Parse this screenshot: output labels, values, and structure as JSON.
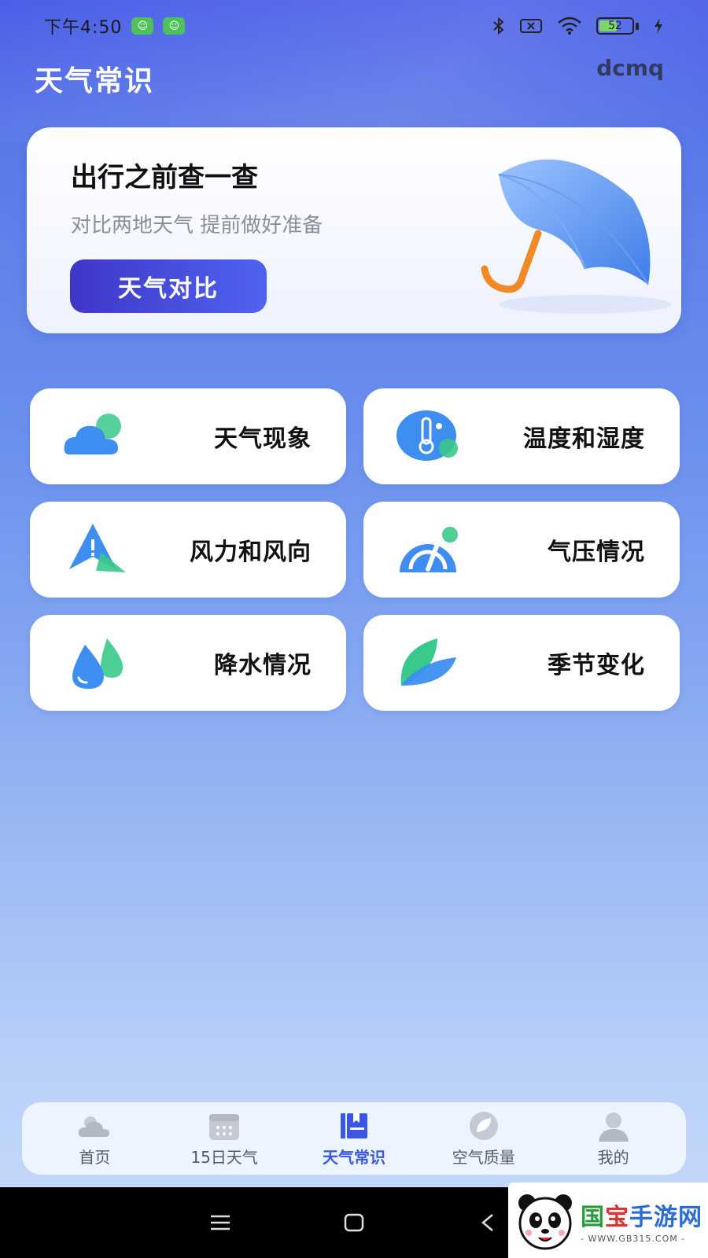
{
  "status_bar": {
    "time": "下午4:50",
    "battery": "52"
  },
  "header": {
    "title": "天气常识",
    "tag": "dcmq"
  },
  "promo": {
    "title": "出行之前查一查",
    "subtitle": "对比两地天气 提前做好准备",
    "button_label": "天气对比"
  },
  "knowledge_tiles": [
    {
      "label": "天气现象",
      "icon": "cloud-icon"
    },
    {
      "label": "温度和湿度",
      "icon": "thermometer-icon"
    },
    {
      "label": "风力和风向",
      "icon": "wind-direction-icon"
    },
    {
      "label": "气压情况",
      "icon": "gauge-icon"
    },
    {
      "label": "降水情况",
      "icon": "raindrop-icon"
    },
    {
      "label": "季节变化",
      "icon": "leaf-icon"
    }
  ],
  "tabbar": {
    "active_index": 2,
    "items": [
      {
        "label": "首页",
        "icon": "sun-cloud-icon"
      },
      {
        "label": "15日天气",
        "icon": "calendar-icon"
      },
      {
        "label": "天气常识",
        "icon": "book-icon"
      },
      {
        "label": "空气质量",
        "icon": "leaf-circle-icon"
      },
      {
        "label": "我的",
        "icon": "person-icon"
      }
    ]
  },
  "watermark": {
    "name_part1": "国",
    "name_part2": "宝",
    "name_part3": "手游网",
    "site": "- WWW.GB315.COM -"
  },
  "colors": {
    "accent": "#3b55e6",
    "button_start": "#3f36c8",
    "button_end": "#4f63f0",
    "icon_blue": "#3d8ef0",
    "icon_green": "#39c98a"
  }
}
